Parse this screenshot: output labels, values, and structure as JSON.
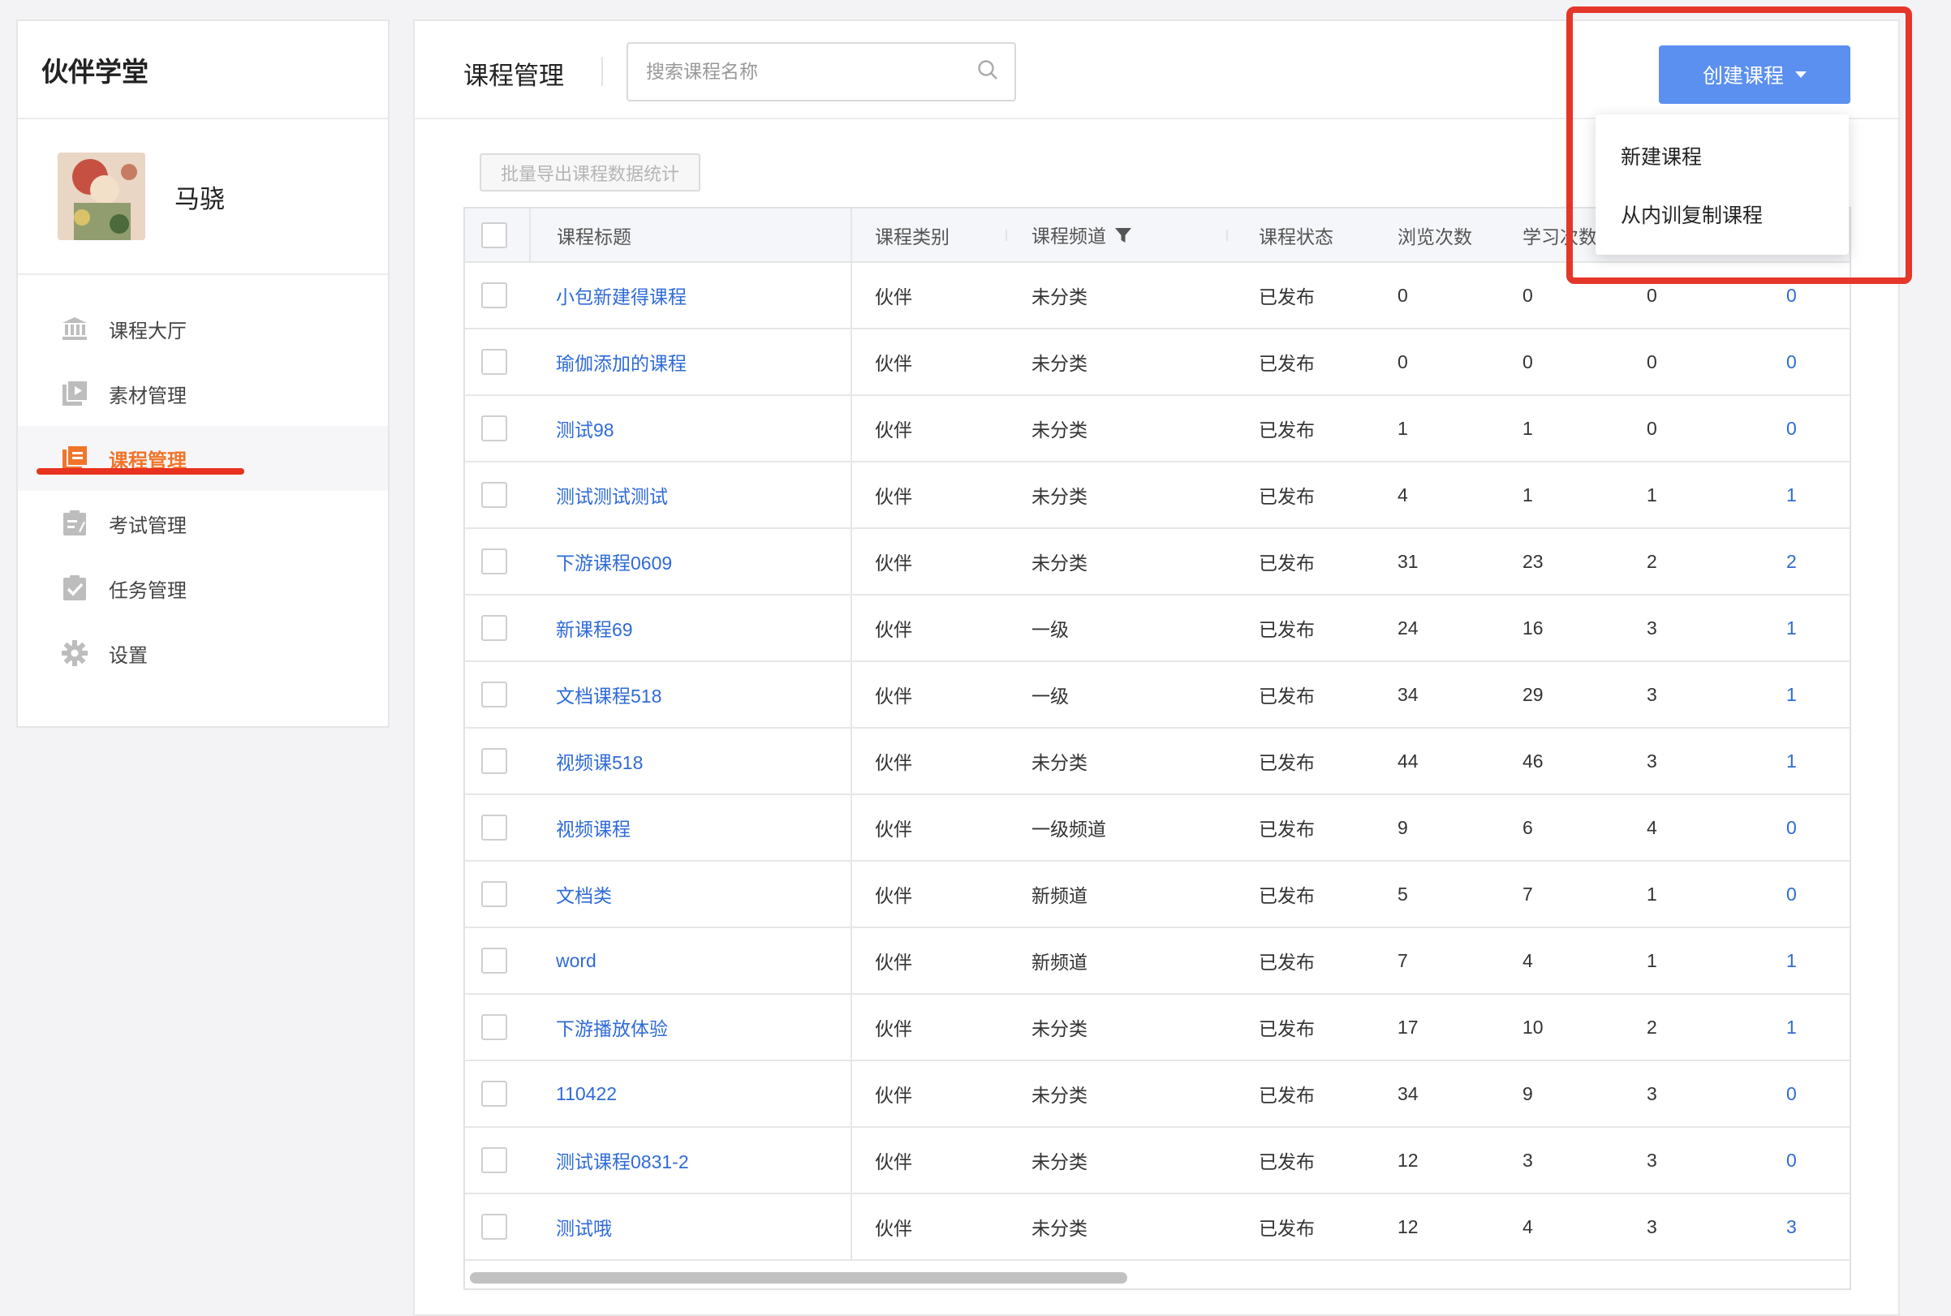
{
  "app": {
    "brand": "伙伴学堂"
  },
  "user": {
    "name": "马骁"
  },
  "sidebar": {
    "items": [
      {
        "label": "课程大厅",
        "icon": "bank-icon"
      },
      {
        "label": "素材管理",
        "icon": "media-icon"
      },
      {
        "label": "课程管理",
        "icon": "course-icon",
        "active": true
      },
      {
        "label": "考试管理",
        "icon": "exam-icon"
      },
      {
        "label": "任务管理",
        "icon": "task-icon"
      },
      {
        "label": "设置",
        "icon": "gear-icon"
      }
    ]
  },
  "header": {
    "title": "课程管理",
    "search_placeholder": "搜索课程名称",
    "create_button": "创建课程"
  },
  "dropdown": {
    "items": [
      "新建课程",
      "从内训复制课程"
    ]
  },
  "toolbar": {
    "export_label": "批量导出课程数据统计"
  },
  "table": {
    "columns": [
      "课程标题",
      "课程类别",
      "课程频道",
      "课程状态",
      "浏览次数",
      "学习次数"
    ],
    "rows": [
      {
        "title": "小包新建得课程",
        "cat": "伙伴",
        "channel": "未分类",
        "status": "已发布",
        "views": "0",
        "study": "0",
        "c7": "0",
        "c8": "0"
      },
      {
        "title": "瑜伽添加的课程",
        "cat": "伙伴",
        "channel": "未分类",
        "status": "已发布",
        "views": "0",
        "study": "0",
        "c7": "0",
        "c8": "0"
      },
      {
        "title": "测试98",
        "cat": "伙伴",
        "channel": "未分类",
        "status": "已发布",
        "views": "1",
        "study": "1",
        "c7": "0",
        "c8": "0"
      },
      {
        "title": "测试测试测试",
        "cat": "伙伴",
        "channel": "未分类",
        "status": "已发布",
        "views": "4",
        "study": "1",
        "c7": "1",
        "c8": "1"
      },
      {
        "title": "下游课程0609",
        "cat": "伙伴",
        "channel": "未分类",
        "status": "已发布",
        "views": "31",
        "study": "23",
        "c7": "2",
        "c8": "2"
      },
      {
        "title": "新课程69",
        "cat": "伙伴",
        "channel": "一级",
        "status": "已发布",
        "views": "24",
        "study": "16",
        "c7": "3",
        "c8": "1"
      },
      {
        "title": "文档课程518",
        "cat": "伙伴",
        "channel": "一级",
        "status": "已发布",
        "views": "34",
        "study": "29",
        "c7": "3",
        "c8": "1"
      },
      {
        "title": "视频课518",
        "cat": "伙伴",
        "channel": "未分类",
        "status": "已发布",
        "views": "44",
        "study": "46",
        "c7": "3",
        "c8": "1"
      },
      {
        "title": "视频课程",
        "cat": "伙伴",
        "channel": "一级频道",
        "status": "已发布",
        "views": "9",
        "study": "6",
        "c7": "4",
        "c8": "0"
      },
      {
        "title": "文档类",
        "cat": "伙伴",
        "channel": "新频道",
        "status": "已发布",
        "views": "5",
        "study": "7",
        "c7": "1",
        "c8": "0"
      },
      {
        "title": "word",
        "cat": "伙伴",
        "channel": "新频道",
        "status": "已发布",
        "views": "7",
        "study": "4",
        "c7": "1",
        "c8": "1"
      },
      {
        "title": "下游播放体验",
        "cat": "伙伴",
        "channel": "未分类",
        "status": "已发布",
        "views": "17",
        "study": "10",
        "c7": "2",
        "c8": "1"
      },
      {
        "title": "110422",
        "cat": "伙伴",
        "channel": "未分类",
        "status": "已发布",
        "views": "34",
        "study": "9",
        "c7": "3",
        "c8": "0"
      },
      {
        "title": "测试课程0831-2",
        "cat": "伙伴",
        "channel": "未分类",
        "status": "已发布",
        "views": "12",
        "study": "3",
        "c7": "3",
        "c8": "0"
      },
      {
        "title": "测试哦",
        "cat": "伙伴",
        "channel": "未分类",
        "status": "已发布",
        "views": "12",
        "study": "4",
        "c7": "3",
        "c8": "3"
      }
    ]
  },
  "colors": {
    "accent": "#5b8ff0",
    "active_nav": "#f0752a",
    "link": "#2f6bd7",
    "highlight": "#e4372a"
  }
}
